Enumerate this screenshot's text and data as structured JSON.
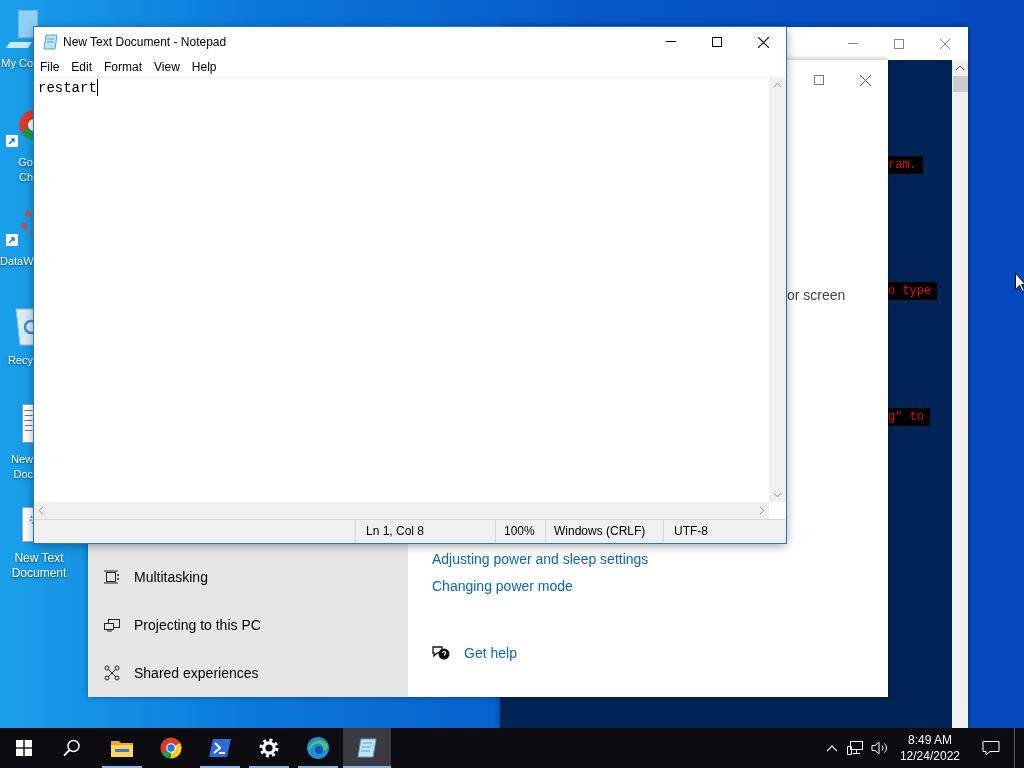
{
  "desktop_icons": [
    {
      "kind": "computer",
      "lines": [
        "My Co"
      ],
      "partly_hidden": true
    },
    {
      "kind": "chrome",
      "lines": [
        "Go",
        "Ch"
      ],
      "partly_hidden": true
    },
    {
      "kind": "dataw",
      "lines": [
        "DataW"
      ],
      "partly_hidden": true
    },
    {
      "kind": "recycle",
      "lines": [
        "Recy"
      ],
      "partly_hidden": true
    },
    {
      "kind": "document",
      "lines": [
        "New",
        "Doc"
      ],
      "partly_hidden": true
    },
    {
      "kind": "textfile",
      "lines": [
        "New Text Document"
      ],
      "partly_hidden": false
    }
  ],
  "console_window": {
    "visible_text": [
      "ram.",
      "o type",
      "g\" to"
    ]
  },
  "settings_window": {
    "partial_text": "or screen",
    "nav_items": [
      {
        "kind": "multitasking",
        "label": "Multitasking"
      },
      {
        "kind": "projecting",
        "label": "Projecting to this PC"
      },
      {
        "kind": "shared",
        "label": "Shared experiences"
      }
    ],
    "links": [
      "Adjusting power and sleep settings",
      "Changing power mode"
    ],
    "help_link": "Get help"
  },
  "notepad": {
    "title": "New Text Document - Notepad",
    "menu": [
      "File",
      "Edit",
      "Format",
      "View",
      "Help"
    ],
    "text": "restart",
    "status": {
      "position": "Ln 1, Col 8",
      "zoom": "100%",
      "line_endings": "Windows (CRLF)",
      "encoding": "UTF-8"
    }
  },
  "taskbar": {
    "apps": [
      {
        "kind": "explorer",
        "running": true,
        "active": false
      },
      {
        "kind": "chrome",
        "running": false,
        "active": false
      },
      {
        "kind": "terminal",
        "running": true,
        "active": false
      },
      {
        "kind": "settings",
        "running": true,
        "active": false
      },
      {
        "kind": "edge",
        "running": true,
        "active": false
      },
      {
        "kind": "notepad",
        "running": true,
        "active": true
      }
    ],
    "time": "8:49 AM",
    "date": "12/24/2022"
  }
}
